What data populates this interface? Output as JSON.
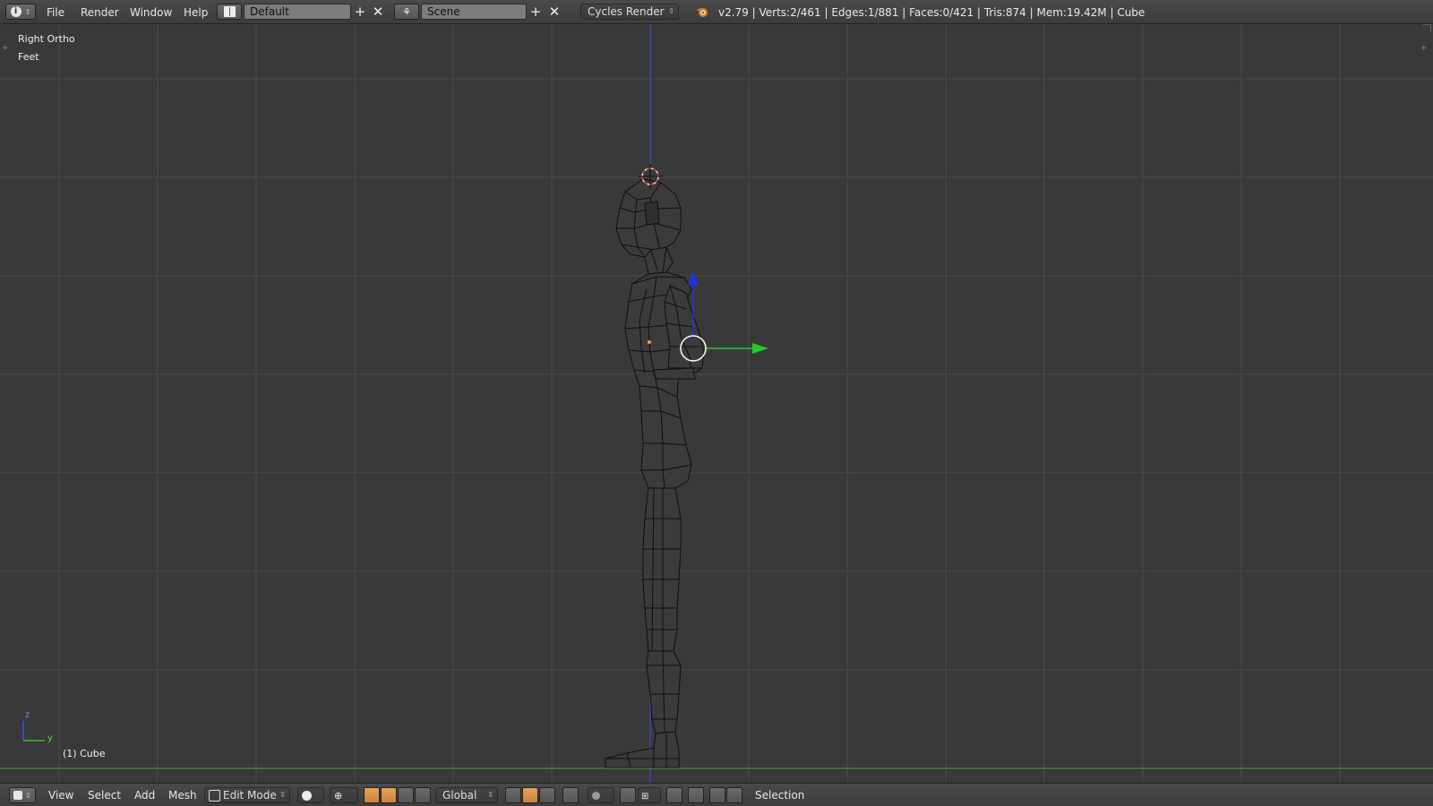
{
  "header": {
    "menus": [
      "File",
      "Render",
      "Window",
      "Help"
    ],
    "screen_layout": "Default",
    "scene": "Scene",
    "render_engine": "Cycles Render",
    "stats": "v2.79 | Verts:2/461 | Edges:1/881 | Faces:0/421 | Tris:874 | Mem:19.42M | Cube"
  },
  "viewport": {
    "view_name": "Right Ortho",
    "units": "Feet",
    "object_label": "(1) Cube",
    "axis_z": "z",
    "axis_y": "y"
  },
  "footer": {
    "menus": [
      "View",
      "Select",
      "Add",
      "Mesh"
    ],
    "mode": "Edit Mode",
    "orientation": "Global",
    "select_label": "Selection"
  },
  "colors": {
    "grid": "#4a4a4a",
    "axis_z": "#3a3aff",
    "axis_y": "#36c236",
    "manip_y": "#22cc22",
    "manip_z": "#2233dd",
    "cursor": "#d04040",
    "mesh_fill": "#3a3a3a",
    "mesh_edge": "#111111"
  }
}
